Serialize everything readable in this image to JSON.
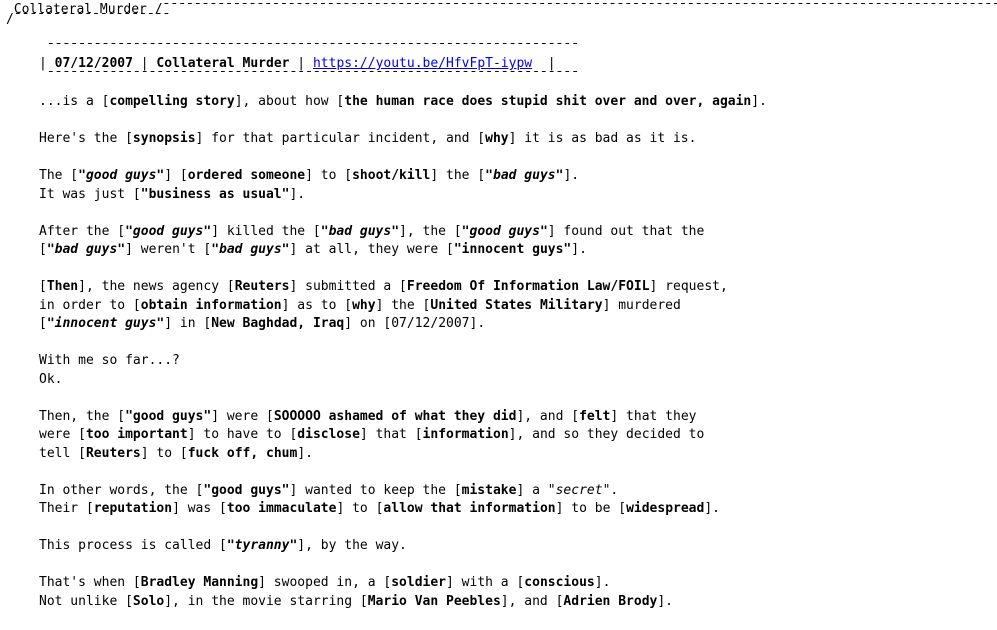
{
  "window": {
    "title": "Collateral Murder"
  },
  "header": {
    "date": "07/12/2007",
    "title": "Collateral Murder",
    "link": "https://youtu.be/HfvFpT-iypw"
  },
  "body": {
    "p1": {
      "a": "...is a [",
      "b": "compelling story",
      "c": "], about how [",
      "d": "the human race does stupid shit over and over, again",
      "e": "]."
    },
    "p2": {
      "a": "Here's the [",
      "b": "synopsis",
      "c": "] for that particular incident, and [",
      "d": "why",
      "e": "] it is as bad as it is."
    },
    "p3": {
      "l1a": "The [",
      "l1b": "\"good guys\"",
      "l1c": "] [",
      "l1d": "ordered someone",
      "l1e": "] to [",
      "l1f": "shoot/kill",
      "l1g": "] the [",
      "l1h": "\"bad guys\"",
      "l1i": "].",
      "l2a": "It was just [",
      "l2b": "\"business as usual\"",
      "l2c": "]."
    },
    "p4": {
      "l1a": "After the [",
      "l1b": "\"good guys\"",
      "l1c": "] killed the [",
      "l1d": "\"bad guys\"",
      "l1e": "], the [",
      "l1f": "\"good guys\"",
      "l1g": "] found out that the",
      "l2a": "[",
      "l2b": "\"bad guys\"",
      "l2c": "] weren't [",
      "l2d": "\"bad guys\"",
      "l2e": "] at all, they were [",
      "l2f": "\"innocent guys\"",
      "l2g": "]."
    },
    "p5": {
      "l1a": "[",
      "l1b": "Then",
      "l1c": "], the news agency [",
      "l1d": "Reuters",
      "l1e": "] submitted a [",
      "l1f": "Freedom Of Information Law/FOIL",
      "l1g": "] request,",
      "l2a": "in order to [",
      "l2b": "obtain information",
      "l2c": "] as to [",
      "l2d": "why",
      "l2e": "] the [",
      "l2f": "United States Military",
      "l2g": "] murdered",
      "l3a": "[",
      "l3b": "\"innocent guys\"",
      "l3c": "] in [",
      "l3d": "New Baghdad, Iraq",
      "l3e": "] on [",
      "l3f": "07/12/2007",
      "l3g": "]."
    },
    "p6": {
      "l1": "With me so far...?",
      "l2": "Ok."
    },
    "p7": {
      "l1a": "Then, the [",
      "l1b": "\"good guys\"",
      "l1c": "] were [",
      "l1d": "SOOOOO ashamed of what they did",
      "l1e": "], and [",
      "l1f": "felt",
      "l1g": "] that they",
      "l2a": "were [",
      "l2b": "too important",
      "l2c": "] to have to [",
      "l2d": "disclose",
      "l2e": "] that [",
      "l2f": "information",
      "l2g": "], and so they decided to",
      "l3a": "tell [",
      "l3b": "Reuters",
      "l3c": "] to [",
      "l3d": "fuck off, chum",
      "l3e": "]."
    },
    "p8": {
      "l1a": "In other words, the [",
      "l1b": "\"good guys\"",
      "l1c": "] wanted to keep the [",
      "l1d": "mistake",
      "l1e": "] a \"",
      "l1f": "secret",
      "l1g": "\".",
      "l2a": "Their [",
      "l2b": "reputation",
      "l2c": "] was [",
      "l2d": "too immaculate",
      "l2e": "] to [",
      "l2f": "allow that information",
      "l2g": "] to be [",
      "l2h": "widespread",
      "l2i": "]."
    },
    "p9": {
      "a": "This process is called [",
      "b": "\"tyranny\"",
      "c": "], by the way."
    },
    "p10": {
      "l1a": "That's when [",
      "l1b": "Bradley Manning",
      "l1c": "] swooped in, a [",
      "l1d": "soldier",
      "l1e": "] with a [",
      "l1f": "conscious",
      "l1g": "].",
      "l2a": "Not unlike [",
      "l2b": "Solo",
      "l2c": "], in the movie starring [",
      "l2d": "Mario Van Peebles",
      "l2e": "], and [",
      "l2f": "Adrien Brody",
      "l2g": "]."
    }
  }
}
